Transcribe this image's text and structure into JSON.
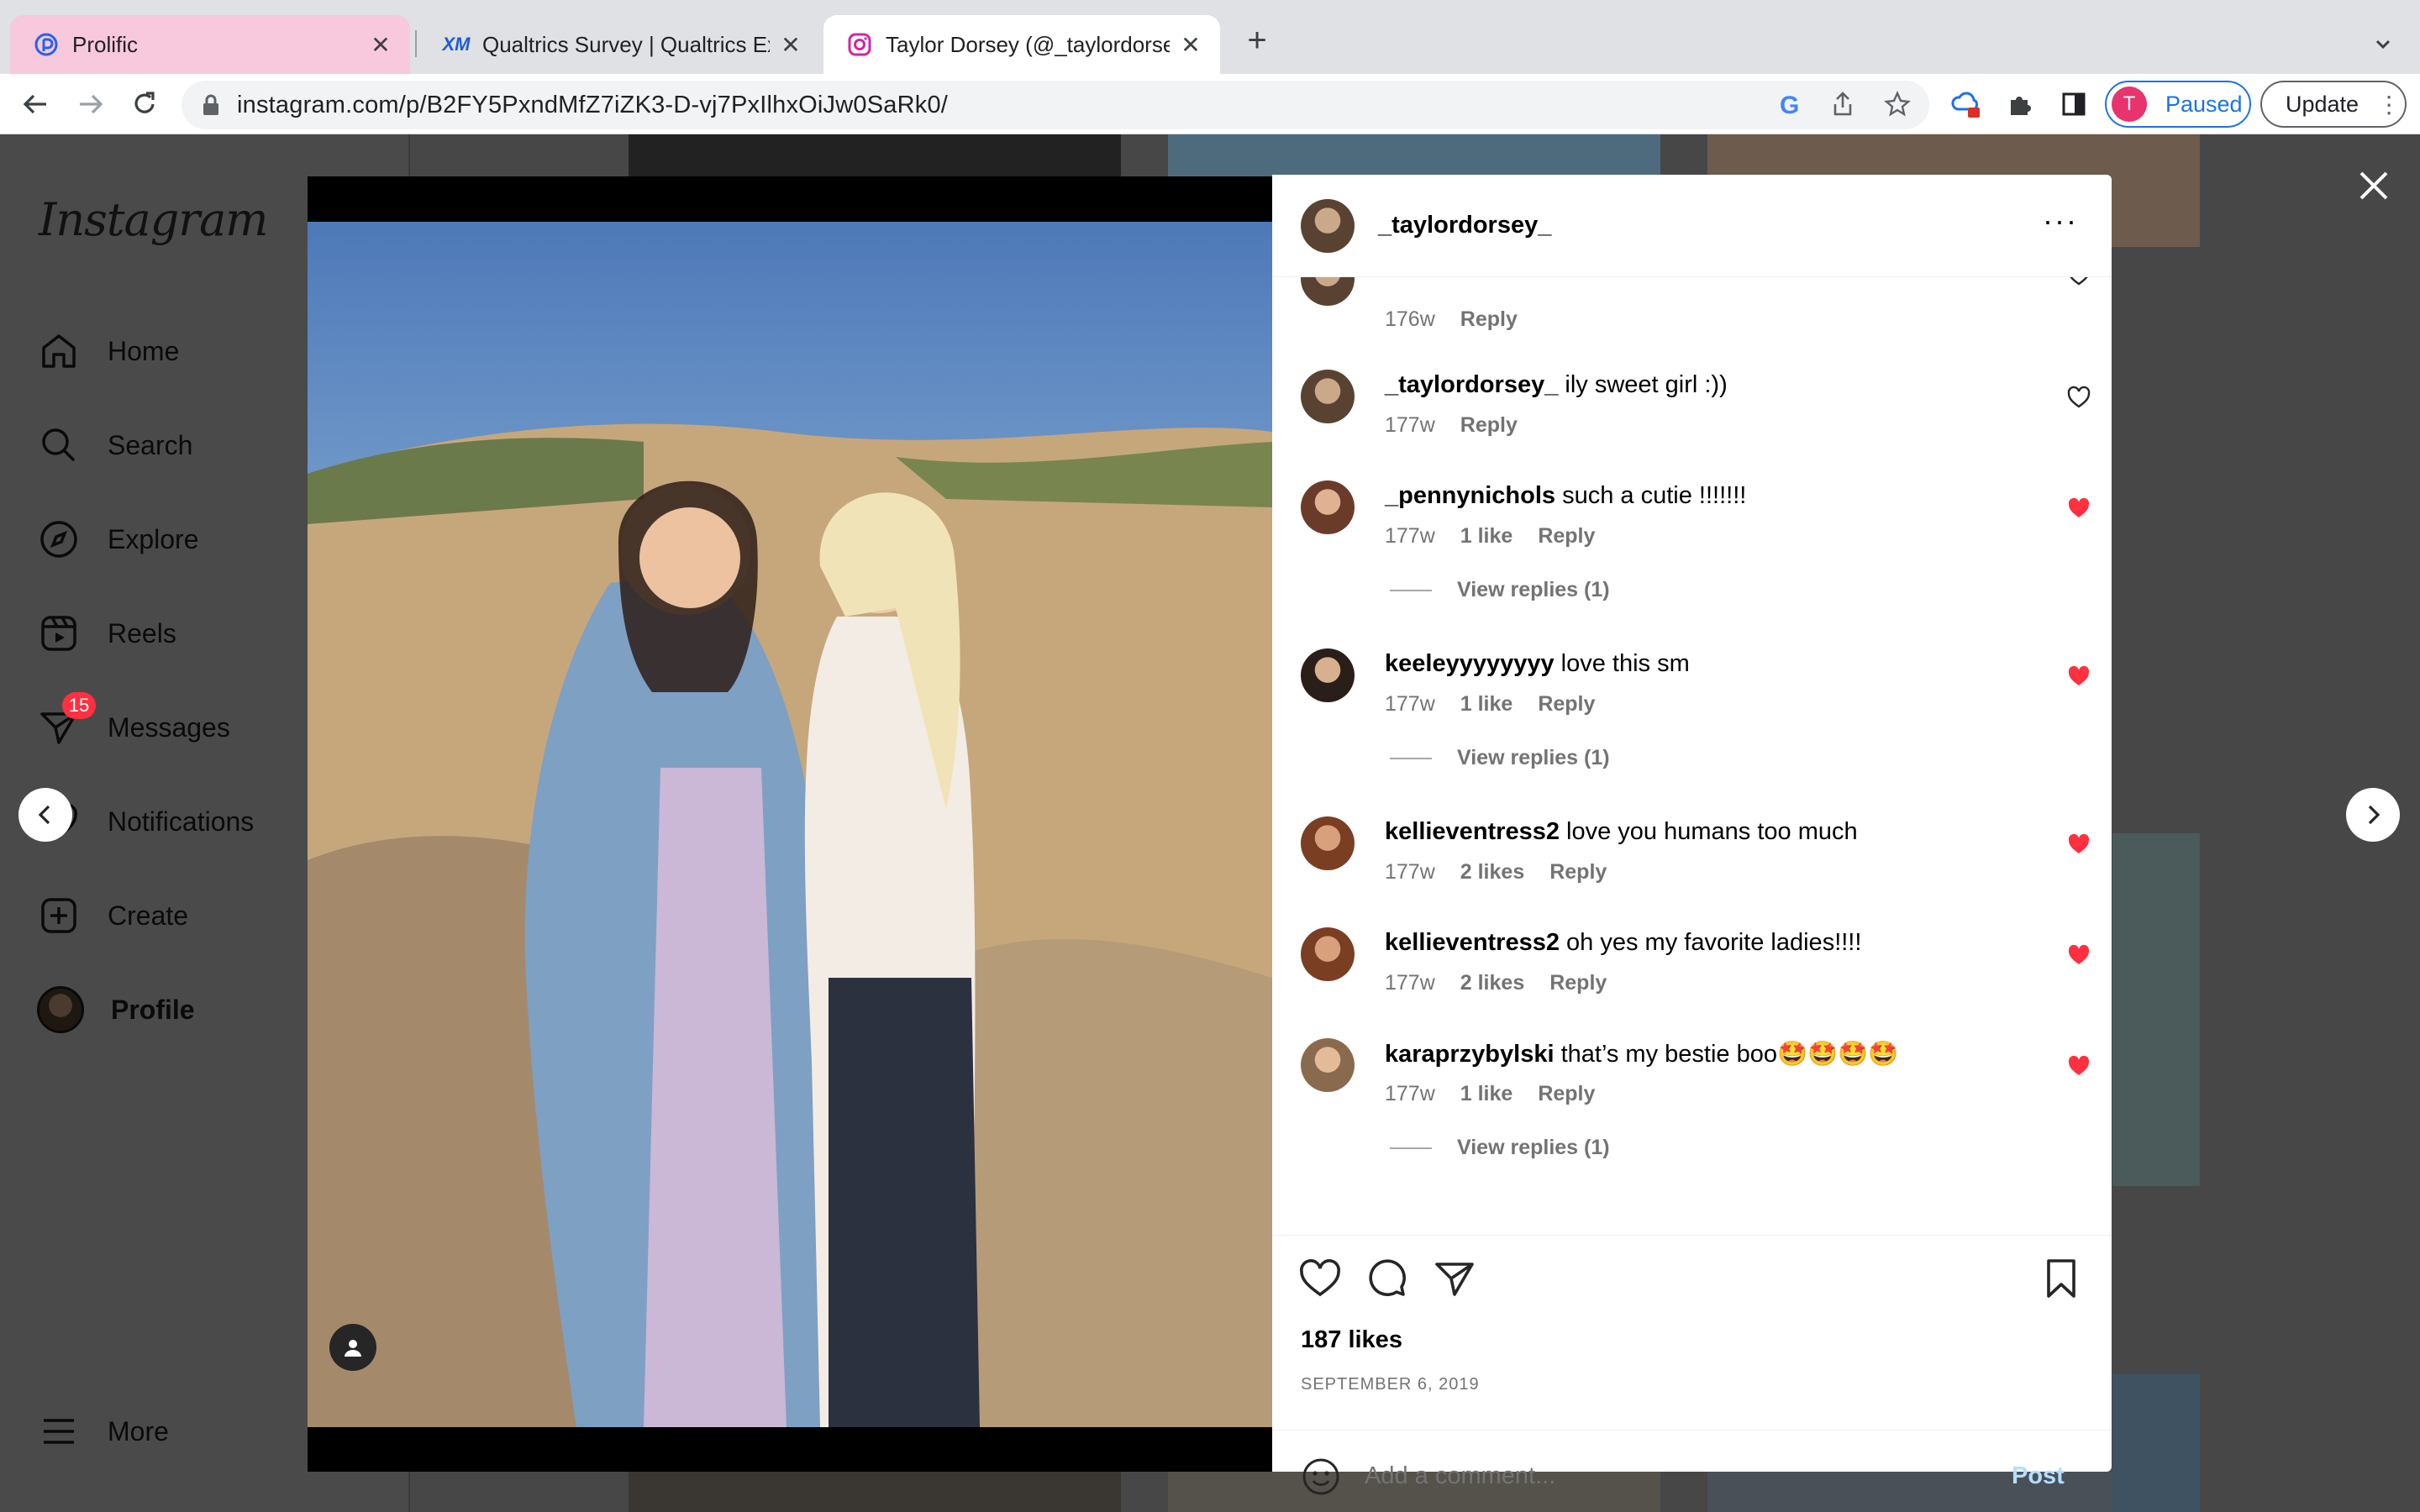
{
  "browser": {
    "tabs": [
      {
        "title": "Prolific",
        "favicon": "prolific-icon",
        "active": false
      },
      {
        "title": "Qualtrics Survey | Qualtrics Exp",
        "favicon": "qualtrics-xm-icon",
        "active": false
      },
      {
        "title": "Taylor Dorsey (@_taylordorsey",
        "favicon": "instagram-icon",
        "active": true
      }
    ],
    "url": "instagram.com/p/B2FY5PxndMfZ7iZK3-D-vj7PxIlhxOiJw0SaRk0/",
    "profile_initial": "T",
    "profile_status": "Paused",
    "update_label": "Update",
    "new_tab_symbol": "+",
    "close_symbol": "✕"
  },
  "sidebar": {
    "logo": "Instagram",
    "items": [
      {
        "label": "Home",
        "icon": "home-icon"
      },
      {
        "label": "Search",
        "icon": "search-icon"
      },
      {
        "label": "Explore",
        "icon": "compass-icon"
      },
      {
        "label": "Reels",
        "icon": "reels-icon"
      },
      {
        "label": "Messages",
        "icon": "messenger-icon",
        "badge": "15"
      },
      {
        "label": "Notifications",
        "icon": "heart-icon"
      },
      {
        "label": "Create",
        "icon": "plus-square-icon"
      },
      {
        "label": "Profile",
        "icon": "profile-avatar"
      },
      {
        "label": "More",
        "icon": "hamburger-icon"
      }
    ]
  },
  "post": {
    "username": "_taylordorsey_",
    "more_symbol": "···",
    "comments": [
      {
        "user": "",
        "text": "",
        "time": "176w",
        "likes": "",
        "reply": "Reply",
        "liked": false,
        "partial": true
      },
      {
        "user": "_taylordorsey_",
        "text": "ily sweet girl :))",
        "time": "177w",
        "likes": "",
        "reply": "Reply",
        "liked": false
      },
      {
        "user": "_pennynichols",
        "text": "such a cutie !!!!!!!",
        "time": "177w",
        "likes": "1 like",
        "reply": "Reply",
        "liked": true,
        "view_replies": "View replies (1)"
      },
      {
        "user": "keeleyyyyyyyy",
        "text": "love this sm",
        "time": "177w",
        "likes": "1 like",
        "reply": "Reply",
        "liked": true,
        "view_replies": "View replies (1)"
      },
      {
        "user": "kellieventress2",
        "text": "love you humans too much",
        "time": "177w",
        "likes": "2 likes",
        "reply": "Reply",
        "liked": true
      },
      {
        "user": "kellieventress2",
        "text": "oh yes my favorite ladies!!!!",
        "time": "177w",
        "likes": "2 likes",
        "reply": "Reply",
        "liked": true
      },
      {
        "user": "karaprzybylski",
        "text": "that’s my bestie boo🤩🤩🤩🤩",
        "time": "177w",
        "likes": "1 like",
        "reply": "Reply",
        "liked": true,
        "view_replies": "View replies (1)"
      }
    ],
    "likes": "187 likes",
    "date": "SEPTEMBER 6, 2019",
    "comment_placeholder": "Add a comment...",
    "post_label": "Post"
  },
  "colors": {
    "like_red": "#ff3040",
    "link_blue": "#1a73e8",
    "post_disabled": "#b2dffc"
  }
}
